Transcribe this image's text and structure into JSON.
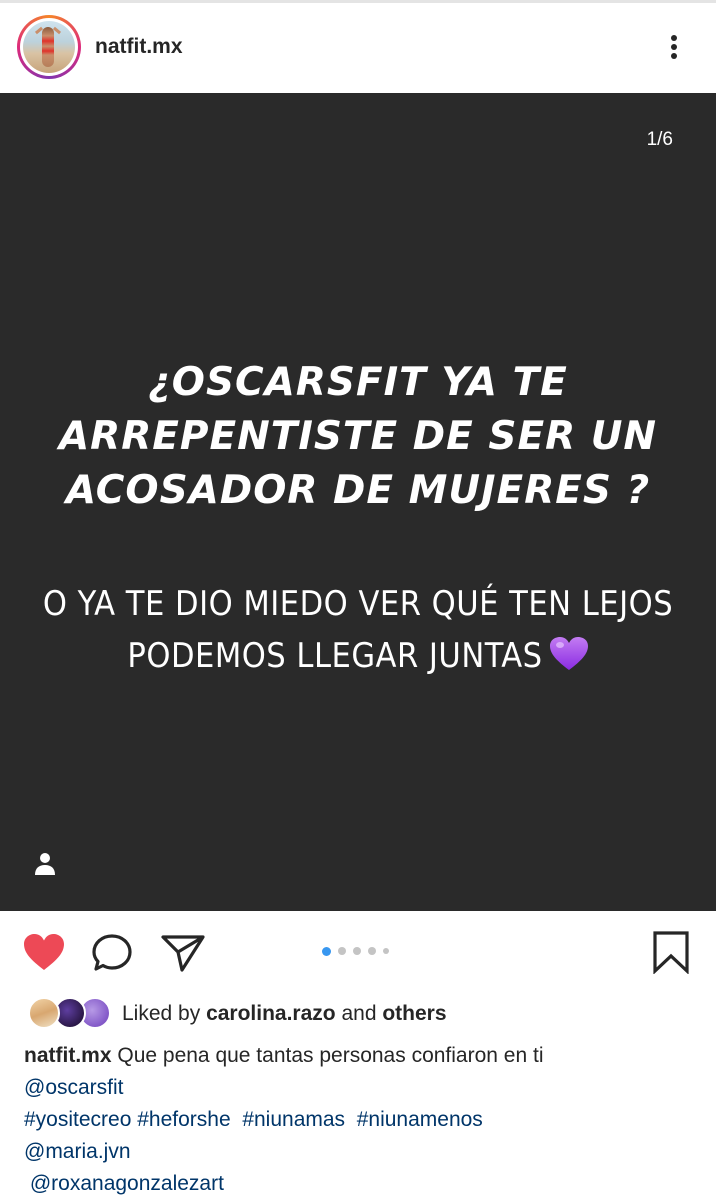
{
  "header": {
    "username": "natfit.mx",
    "more_icon": "more-vertical-icon"
  },
  "post": {
    "counter": "1/6",
    "headline": "¿OSCARSFIT YA TE ARREPENTISTE DE SER UN ACOSADOR DE MUJERES ?",
    "subline": "O YA TE DIO MIEDO VER QUÉ TEN LEJOS PODEMOS LLEGAR JUNTAS",
    "emoji": "purple-heart-emoji",
    "tag_icon": "user-icon"
  },
  "actions": {
    "icons": [
      "heart-filled-icon",
      "comment-icon",
      "share-icon",
      "bookmark-icon"
    ],
    "like_color": "#ed4956",
    "carousel_total": 6,
    "carousel_active": 1
  },
  "likes": {
    "prefix": "Liked by",
    "user": "carolina.razo",
    "and": "and",
    "others": "others"
  },
  "caption": {
    "username": "natfit.mx",
    "text": "Que pena que tantas personas confiaron en ti",
    "mention1": "@oscarsfit",
    "hashtags": [
      "#yositecreo",
      "#heforshe",
      "#niunamas",
      "#niunamenos"
    ],
    "mention2": "@maria.jvn",
    "mention3": "@roxanagonzalezart"
  }
}
